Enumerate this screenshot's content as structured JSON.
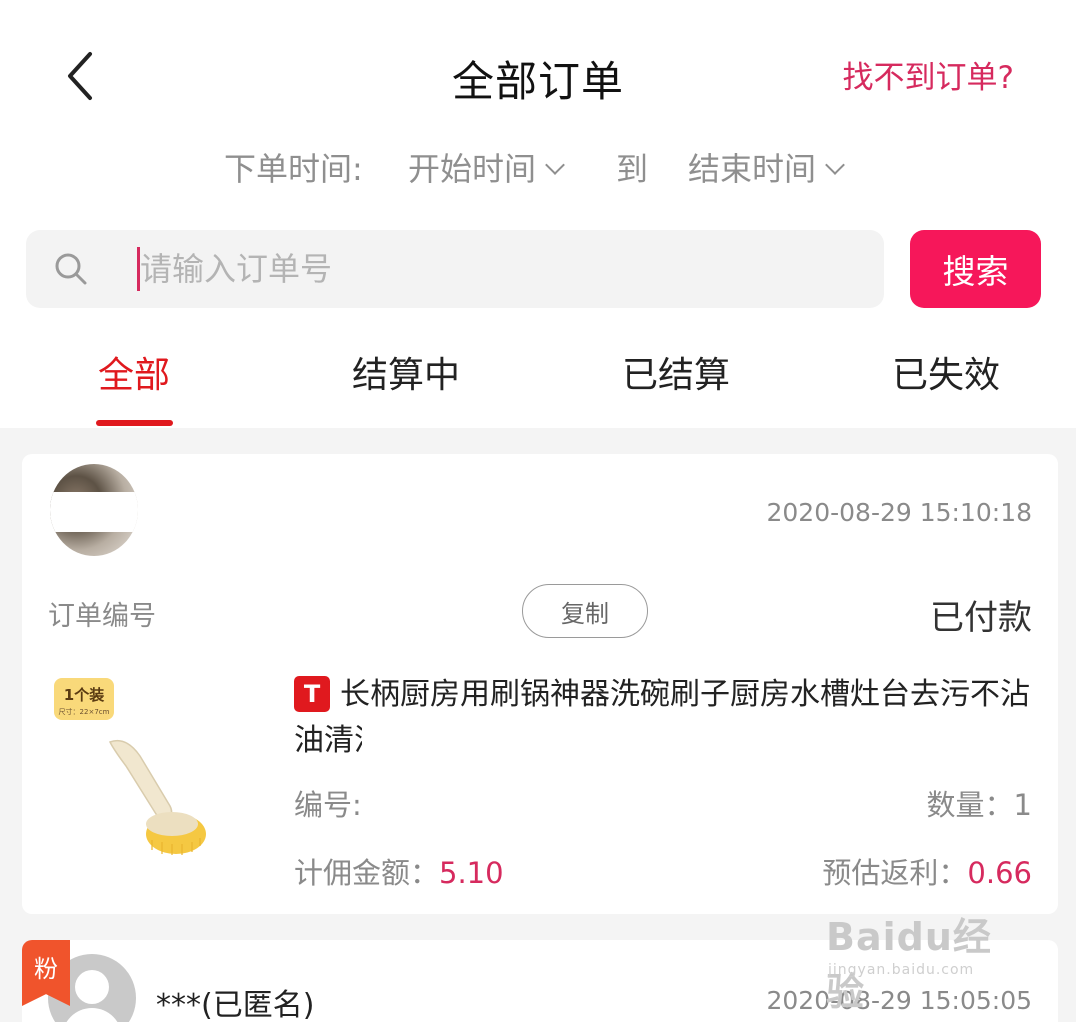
{
  "header": {
    "title": "全部订单",
    "help_link": "找不到订单?"
  },
  "filter": {
    "date_label": "下单时间:",
    "start_time": "开始时间",
    "to": "到",
    "end_time": "结束时间"
  },
  "search": {
    "placeholder": "请输入订单号",
    "button": "搜索"
  },
  "tabs": [
    {
      "label": "全部",
      "active": true
    },
    {
      "label": "结算中",
      "active": false
    },
    {
      "label": "已结算",
      "active": false
    },
    {
      "label": "已失效",
      "active": false
    }
  ],
  "orders": [
    {
      "time": "2020-08-29 15:10:18",
      "order_no_label": "订单编号",
      "copy_label": "复制",
      "status": "已付款",
      "product": {
        "badge": "T",
        "title": "长柄厨房用刷锅神器洗碗刷子厨房水槽灶台去污不沾油清洁锅刷",
        "image_label": "1个装",
        "image_size": "尺寸：22×7cm"
      },
      "pid_label": "编号:",
      "qty_label": "数量：",
      "qty": "1",
      "commission_label": "计佣金额：",
      "commission": "5.10",
      "rebate_label": "预估返利：",
      "rebate": "0.66"
    },
    {
      "fan_badge": "粉",
      "buyer": "***(已匿名)",
      "time": "2020-08-29 15:05:05"
    }
  ],
  "watermark": {
    "logo": "Baidu经验",
    "sub": "jingyan.baidu.com"
  },
  "colors": {
    "accent": "#e0191e",
    "search_button": "#f6175a",
    "money": "#d62a5e"
  }
}
